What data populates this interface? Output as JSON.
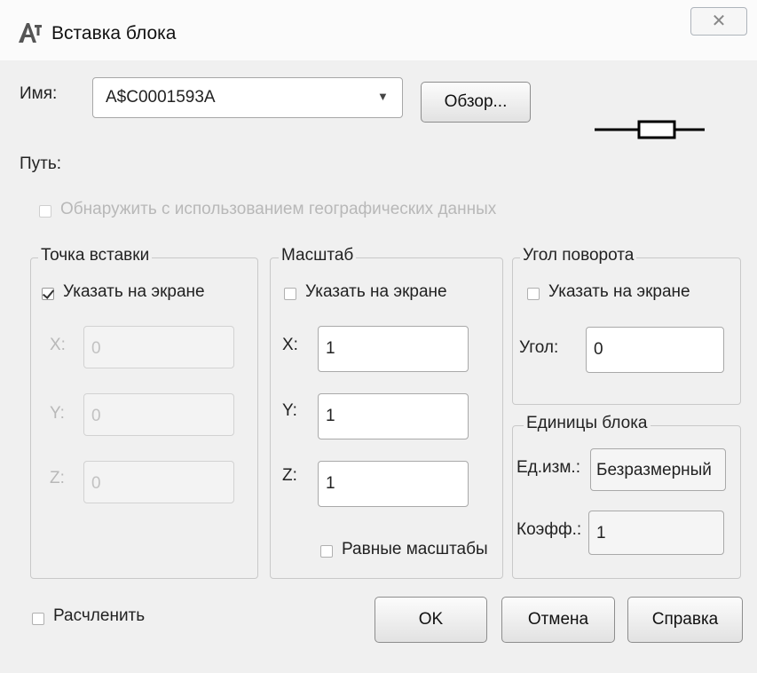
{
  "title": "Вставка блока",
  "close_glyph": "✕",
  "name": {
    "label": "Имя:",
    "value": "A$C0001593A"
  },
  "browse_label": "Обзор...",
  "path_label": "Путь:",
  "geo_checkbox": {
    "label": "Обнаружить с использованием географических данных",
    "checked": false
  },
  "insertion": {
    "title": "Точка вставки",
    "specify_label": "Указать на экране",
    "specify_checked": true,
    "x_label": "X:",
    "x_value": "0",
    "y_label": "Y:",
    "y_value": "0",
    "z_label": "Z:",
    "z_value": "0"
  },
  "scale": {
    "title": "Масштаб",
    "specify_label": "Указать на экране",
    "specify_checked": false,
    "x_label": "X:",
    "x_value": "1",
    "y_label": "Y:",
    "y_value": "1",
    "z_label": "Z:",
    "z_value": "1",
    "uniform_label": "Равные масштабы",
    "uniform_checked": false
  },
  "rotation": {
    "title": "Угол поворота",
    "specify_label": "Указать на экране",
    "specify_checked": false,
    "angle_label": "Угол:",
    "angle_value": "0"
  },
  "units": {
    "title": "Единицы блока",
    "unit_label": "Ед.изм.:",
    "unit_value": "Безразмерный",
    "factor_label": "Коэфф.:",
    "factor_value": "1"
  },
  "explode": {
    "label": "Расчленить",
    "checked": false
  },
  "buttons": {
    "ok": "OK",
    "cancel": "Отмена",
    "help": "Справка"
  }
}
